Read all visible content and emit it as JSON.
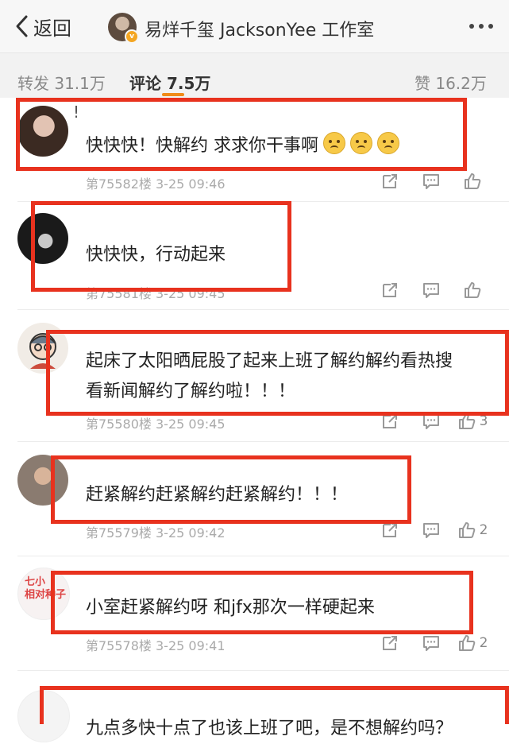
{
  "header": {
    "back_label": "返回",
    "title": "易烊千玺 JacksonYee 工作室"
  },
  "tabs": {
    "repost": "转发 31.1万",
    "comments": "评论 7.5万",
    "likes": "赞 16.2万"
  },
  "comments": [
    {
      "user": "!",
      "text": "快快快！快解约 求求你干事啊",
      "emoji_count": 3,
      "meta": "第75582楼 3-25 09:46",
      "likes": ""
    },
    {
      "user": "",
      "text": "快快快，行动起来",
      "meta": "第75581楼 3-25 09:45",
      "likes": ""
    },
    {
      "user": "",
      "text_lines": [
        "起床了太阳晒屁股了起来上班了解约解约看热搜",
        "看新闻解约了解约啦！！！"
      ],
      "meta": "第75580楼 3-25 09:45",
      "likes": "3"
    },
    {
      "user": "",
      "text": "赶紧解约赶紧解约赶紧解约！！！",
      "meta": "第75579楼 3-25 09:42",
      "likes": "2"
    },
    {
      "user": "",
      "text": "小室赶紧解约呀 和jfx那次一样硬起来",
      "meta": "第75578楼 3-25 09:41",
      "likes": "2"
    },
    {
      "user": "",
      "text": "九点多快十点了也该上班了吧，是不想解约吗？",
      "meta": "",
      "likes": ""
    }
  ],
  "avatar_doodle": "七小\n相对种子",
  "colors": {
    "highlight_box": "#e8321e",
    "tab_accent": "#f08b19"
  },
  "icons": [
    "back-chevron-icon",
    "more-dots-icon",
    "share-icon",
    "comment-icon",
    "like-icon"
  ]
}
